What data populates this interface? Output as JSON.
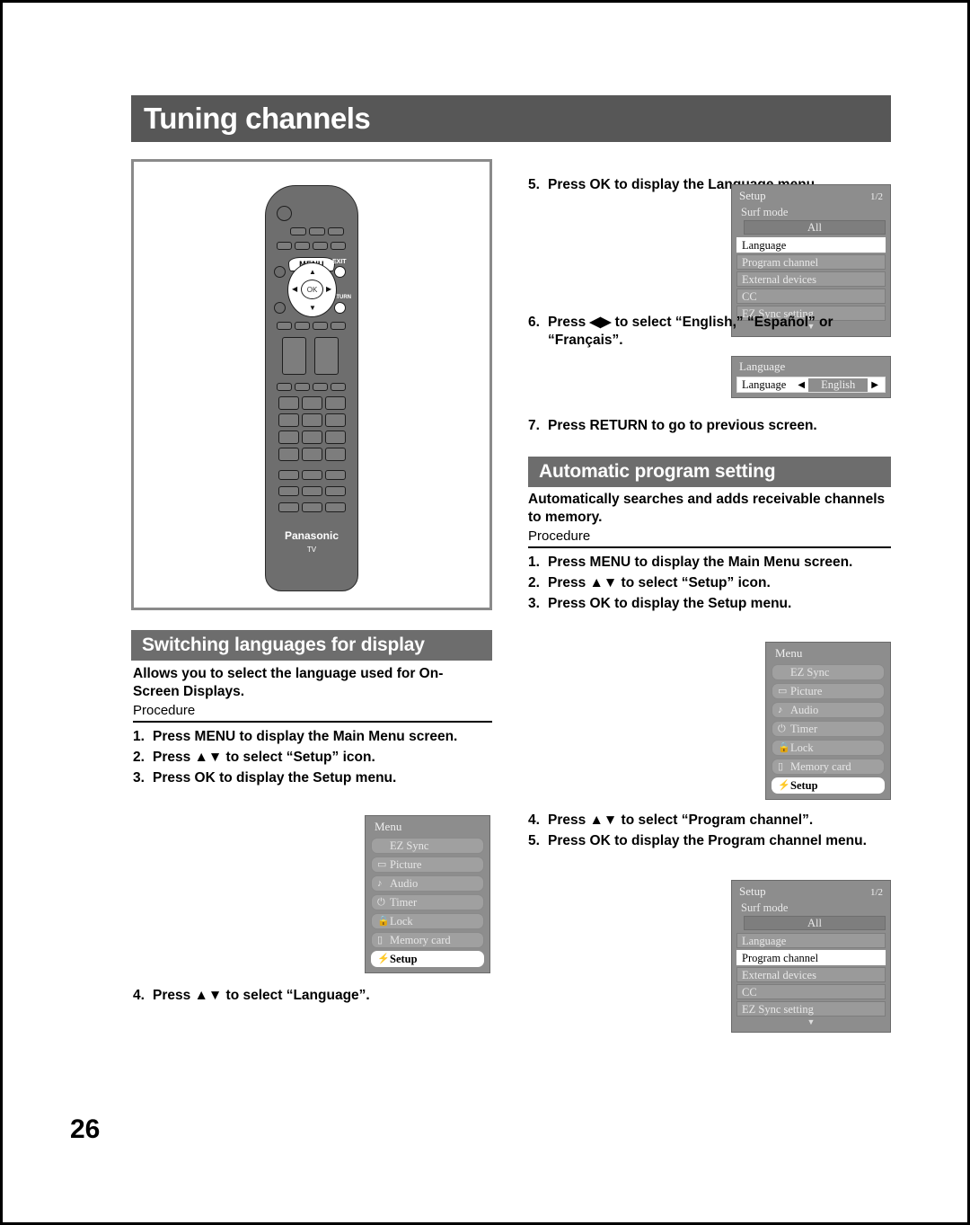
{
  "page": {
    "number": "26",
    "chapter_title": "Tuning channels"
  },
  "remote": {
    "menu_button_label": "MENU",
    "exit_label": "EXIT",
    "return_label": "RETURN",
    "ok_label": "OK",
    "arrow_up": "▲",
    "arrow_down": "▼",
    "arrow_left": "◀",
    "arrow_right": "▶",
    "brand": "Panasonic",
    "brand_sub": "TV"
  },
  "sections": {
    "switching_languages": {
      "title": "Switching languages for display",
      "description": "Allows you to select the language used for On-Screen Displays.",
      "procedure_label": "Procedure",
      "steps": [
        {
          "num": "1.",
          "text": "Press MENU to display the Main Menu screen."
        },
        {
          "num": "2.",
          "text": "Press ▲▼ to select “Setup” icon."
        },
        {
          "num": "3.",
          "text": "Press OK to display the Setup menu."
        }
      ],
      "step4": {
        "num": "4.",
        "text": "Press ▲▼ to select “Language”."
      },
      "step5": {
        "num": "5.",
        "text": "Press OK to display the Language menu."
      },
      "step6": {
        "num": "6.",
        "text": "Press ◀▶ to select “English,” “Español” or “Français”."
      },
      "step7": {
        "num": "7.",
        "text": "Press RETURN to go to previous screen."
      }
    },
    "automatic_program": {
      "title": "Automatic program setting",
      "description": "Automatically searches and adds receivable channels to memory.",
      "procedure_label": "Procedure",
      "steps": [
        {
          "num": "1.",
          "text": "Press MENU to display the Main Menu screen."
        },
        {
          "num": "2.",
          "text": "Press ▲▼ to select “Setup” icon."
        },
        {
          "num": "3.",
          "text": "Press OK to display the Setup menu."
        }
      ],
      "steps2": [
        {
          "num": "4.",
          "text": "Press ▲▼ to select “Program channel”."
        },
        {
          "num": "5.",
          "text": "Press OK to display the Program channel menu."
        }
      ]
    }
  },
  "osd": {
    "main_menu": {
      "title": "Menu",
      "items": [
        {
          "icon": "",
          "label": "EZ Sync",
          "selected": false
        },
        {
          "icon": "▭",
          "label": "Picture",
          "selected": false
        },
        {
          "icon": "♪",
          "label": "Audio",
          "selected": false
        },
        {
          "icon": "⏻",
          "label": "Timer",
          "selected": false
        },
        {
          "icon": "🔒",
          "label": "Lock",
          "selected": false
        },
        {
          "icon": "▯",
          "label": "Memory card",
          "selected": false
        },
        {
          "icon": "⚡",
          "label": "Setup",
          "selected": true
        }
      ]
    },
    "setup_menu_language": {
      "title": "Setup",
      "page": "1/2",
      "surf_mode_label": "Surf mode",
      "surf_mode_value": "All",
      "rows": [
        {
          "label": "Language",
          "selected": true
        },
        {
          "label": "Program channel",
          "selected": false
        },
        {
          "label": "External devices",
          "selected": false
        },
        {
          "label": "CC",
          "selected": false
        },
        {
          "label": "EZ Sync setting",
          "selected": false
        }
      ],
      "scroll_down": "▼"
    },
    "setup_menu_program": {
      "title": "Setup",
      "page": "1/2",
      "surf_mode_label": "Surf mode",
      "surf_mode_value": "All",
      "rows": [
        {
          "label": "Language",
          "selected": false
        },
        {
          "label": "Program channel",
          "selected": true
        },
        {
          "label": "External devices",
          "selected": false
        },
        {
          "label": "CC",
          "selected": false
        },
        {
          "label": "EZ Sync setting",
          "selected": false
        }
      ],
      "scroll_down": "▼"
    },
    "language_panel": {
      "title": "Language",
      "row_label": "Language",
      "value": "English",
      "left_arrow": "◀",
      "right_arrow": "▶"
    }
  }
}
